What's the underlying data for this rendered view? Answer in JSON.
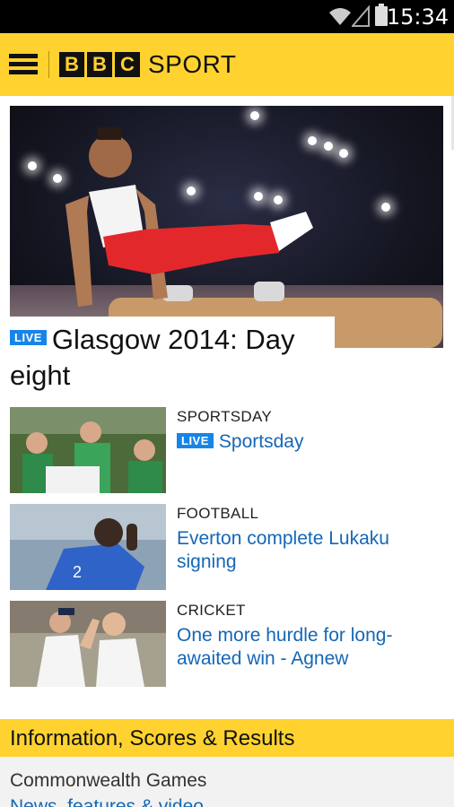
{
  "status_bar": {
    "time": "15:34",
    "icons": [
      "wifi-icon",
      "signal-icon",
      "battery-icon"
    ]
  },
  "header": {
    "logo_letters": [
      "B",
      "B",
      "C"
    ],
    "logo_word": "SPORT",
    "brand_color": "#ffd230",
    "menu_icon": "hamburger-menu-icon"
  },
  "hero": {
    "badge": "LIVE",
    "title": "Glasgow 2014: Day eight",
    "image_desc_icon": "gymnast-pommel-horse-photo"
  },
  "stories": [
    {
      "section": "SPORTSDAY",
      "badge": "LIVE",
      "headline": "Sportsday",
      "thumb": "fans-photo"
    },
    {
      "section": "FOOTBALL",
      "badge": "",
      "headline": "Everton complete Lukaku signing",
      "thumb": "footballer-photo"
    },
    {
      "section": "CRICKET",
      "badge": "",
      "headline": "One more hurdle for long-awaited win - Agnew",
      "thumb": "cricketers-photo"
    }
  ],
  "info": {
    "title": "Information, Scores & Results",
    "item": "Commonwealth Games",
    "link": "News, features & video"
  },
  "colors": {
    "live_badge": "#1785e8",
    "headline_link": "#1467b6",
    "accent": "#ffd230"
  }
}
